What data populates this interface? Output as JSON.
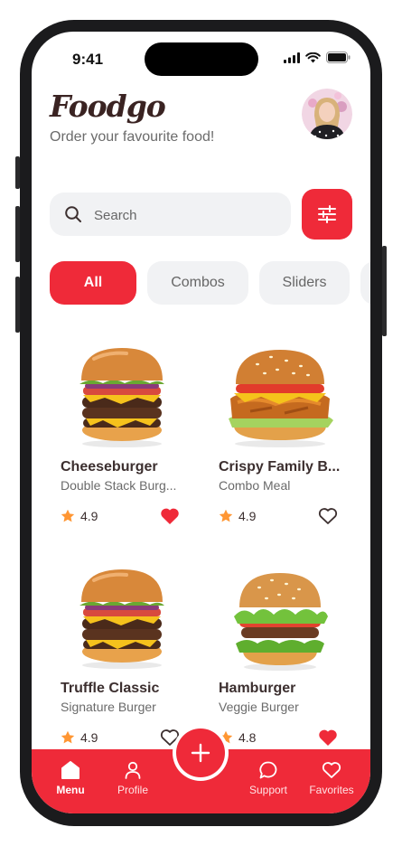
{
  "status": {
    "time": "9:41"
  },
  "header": {
    "brand": "Foodgo",
    "subtitle": "Order your favourite food!"
  },
  "search": {
    "placeholder": "Search"
  },
  "categories": [
    {
      "label": "All",
      "active": true
    },
    {
      "label": "Combos",
      "active": false
    },
    {
      "label": "Sliders",
      "active": false
    }
  ],
  "items": [
    {
      "name": "Cheeseburger",
      "description": "Double Stack Burg...",
      "rating": "4.9",
      "favorite": true
    },
    {
      "name": "Crispy Family B...",
      "description": "Combo Meal",
      "rating": "4.9",
      "favorite": false
    },
    {
      "name": "Truffle Classic",
      "description": "Signature Burger",
      "rating": "4.9",
      "favorite": false
    },
    {
      "name": "Hamburger",
      "description": "Veggie Burger",
      "rating": "4.8",
      "favorite": true
    }
  ],
  "nav": {
    "menu": "Menu",
    "profile": "Profile",
    "support": "Support",
    "favorites": "Favorites"
  },
  "colors": {
    "accent": "#EF2A39",
    "star": "#FF9633",
    "brand_text": "#3A2322"
  }
}
